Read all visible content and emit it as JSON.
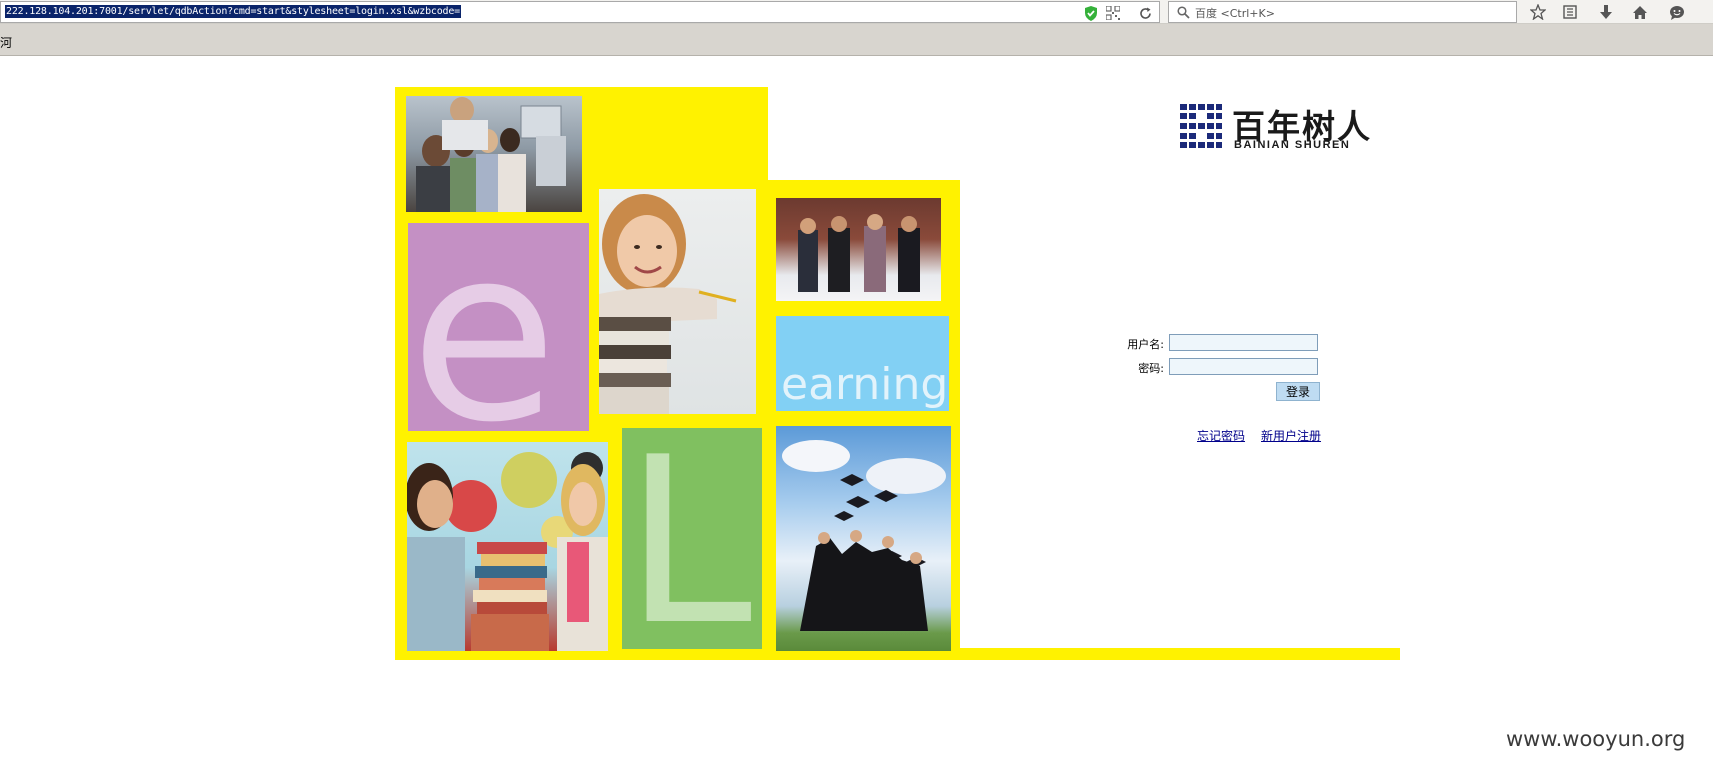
{
  "browser": {
    "url": "222.128.104.201:7001/servlet/qdbAction?cmd=start&stylesheet=login.xsl&wzbcode=",
    "search_placeholder": "百度 <Ctrl+K>",
    "bookmark_label": "河"
  },
  "logo": {
    "name_cn": "百年树人",
    "name_en": "BAINIAN SHUREN"
  },
  "mosaic": {
    "letter_e": "e",
    "letter_l": "L",
    "word": "earning"
  },
  "login": {
    "username_label": "用户名:",
    "password_label": "密码:",
    "username_value": "",
    "password_value": "",
    "submit_label": "登录",
    "forgot_password": "忘记密码",
    "register": "新用户注册"
  },
  "watermark": "www.wooyun.org",
  "colors": {
    "yellow": "#fff200",
    "purple": "#c490c4",
    "sky": "#82d0f4",
    "green": "#80c060",
    "logo_blue": "#1b2a7a"
  }
}
